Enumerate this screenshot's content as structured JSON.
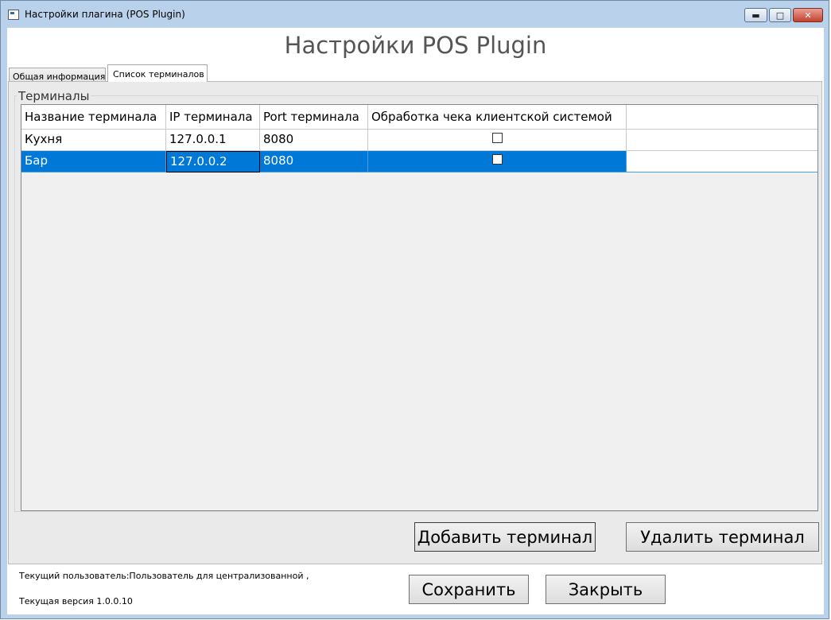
{
  "window": {
    "title": "Настройки плагина (POS Plugin)",
    "minimize_glyph": "▬",
    "maximize_glyph": "□",
    "close_glyph": "✕"
  },
  "header": {
    "title": "Настройки POS Plugin"
  },
  "tabs": [
    {
      "label": "Общая информация",
      "selected": false
    },
    {
      "label": "Список терминалов",
      "selected": true
    }
  ],
  "terminals": {
    "group_label": "Терминалы",
    "columns": [
      "Название терминала",
      "IP терминала",
      "Port терминала",
      "Обработка чека клиентской системой"
    ],
    "rows": [
      {
        "name": "Кухня",
        "ip": "127.0.0.1",
        "port": "8080",
        "client_processing": false,
        "selected": false
      },
      {
        "name": "Бар",
        "ip": "127.0.0.2",
        "port": "8080",
        "client_processing": false,
        "selected": true
      }
    ],
    "add_button": "Добавить терминал",
    "remove_button": "Удалить терминал"
  },
  "footer": {
    "current_user": "Текущий пользователь:Пользователь для централизованной ,",
    "current_version": "Текущая версия 1.0.0.10",
    "save_button": "Сохранить",
    "close_button": "Закрыть"
  },
  "colors": {
    "selection": "#0078d7",
    "window_frame": "#b9d1ea"
  }
}
